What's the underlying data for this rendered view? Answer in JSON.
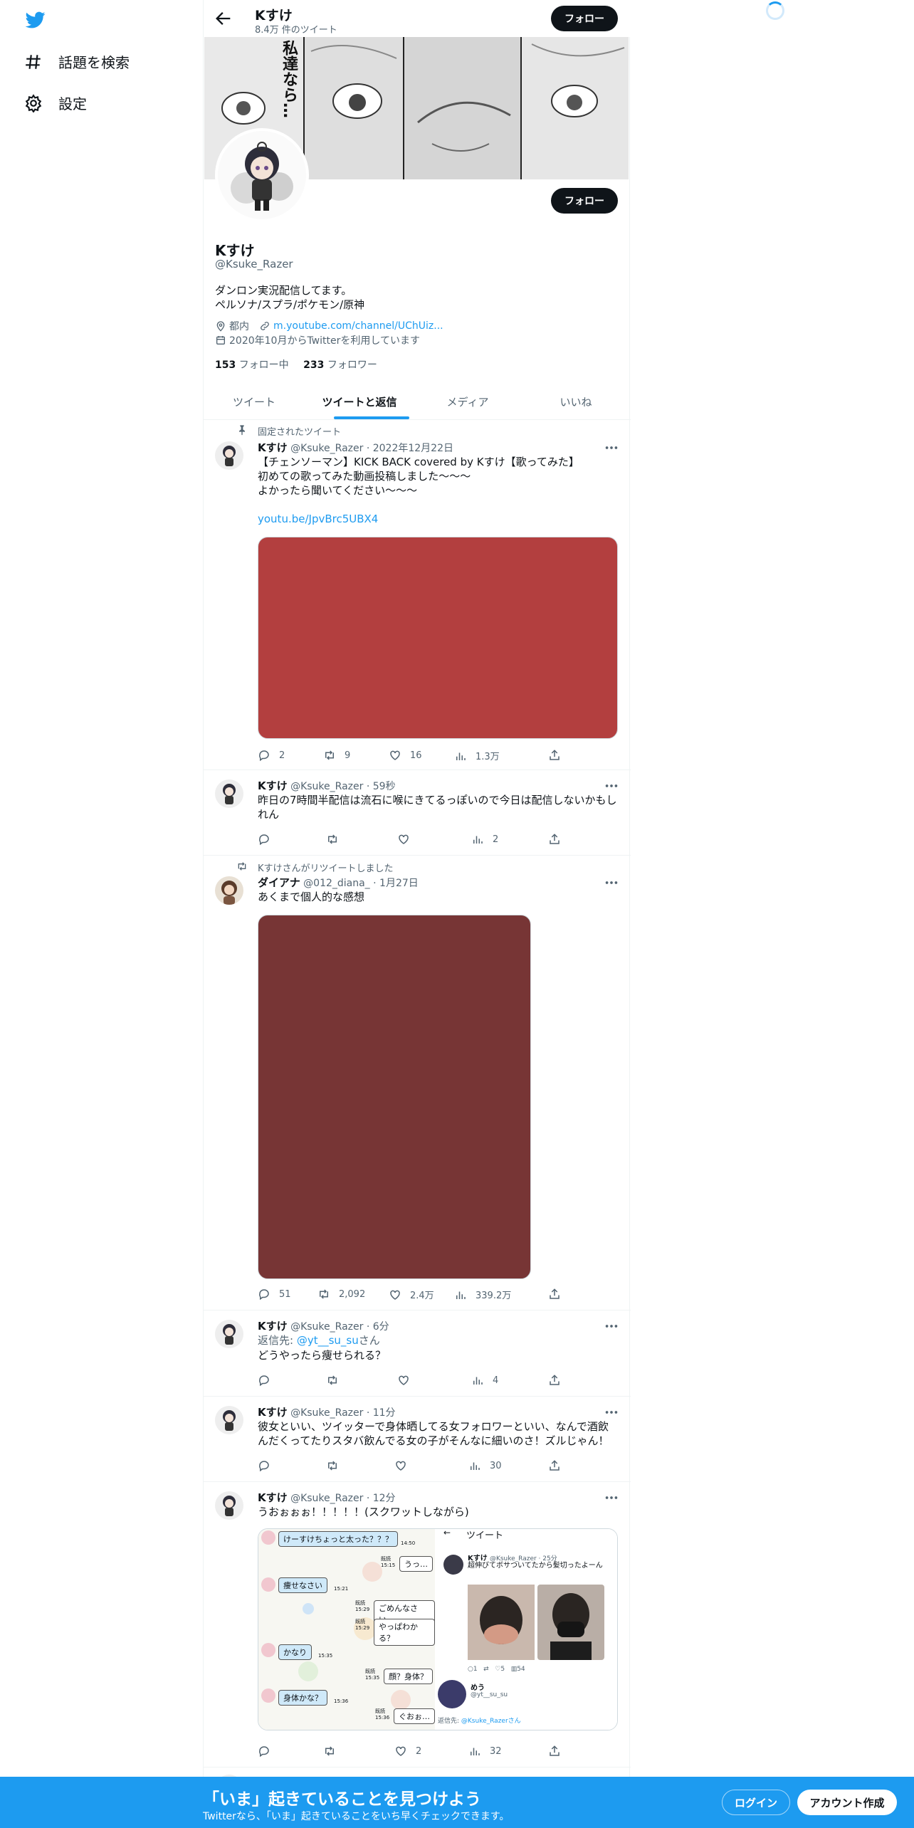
{
  "nav": {
    "items": [
      {
        "label": "話題を検索",
        "icon": "hashtag-icon"
      },
      {
        "label": "設定",
        "icon": "gear-icon"
      }
    ]
  },
  "header": {
    "name": "Kすけ",
    "tweet_count": "8.4万 件のツイート",
    "follow_label": "フォロー"
  },
  "banner": {
    "caption_text": "私達なら…"
  },
  "profile": {
    "follow_label": "フォロー",
    "name": "Kすけ",
    "handle": "@Ksuke_Razer",
    "bio_line1": "ダンロン実況配信してます。",
    "bio_line2": "ペルソナ/スプラ/ポケモン/原神",
    "location": "都内",
    "url": "m.youtube.com/channel/UChUiz...",
    "joined": "2020年10月からTwitterを利用しています",
    "following_count": "153",
    "following_label": "フォロー中",
    "followers_count": "233",
    "followers_label": "フォロワー"
  },
  "tabs": [
    {
      "label": "ツイート",
      "active": false
    },
    {
      "label": "ツイートと返信",
      "active": true
    },
    {
      "label": "メディア",
      "active": false
    },
    {
      "label": "いいね",
      "active": false
    }
  ],
  "tweets": [
    {
      "context": "固定されたツイート",
      "name": "Kすけ",
      "handle": "@Ksuke_Razer",
      "time": "· 2022年12月22日",
      "text": "【チェンソーマン】KICK BACK covered by Kすけ【歌ってみた】\n初めての歌ってみた動画投稿しました～～～\nよかったら聞いてください～～～",
      "link": "youtu.be/JpvBrc5UBX4",
      "media_color": "#b33f3f",
      "replies": "2",
      "retweets": "9",
      "likes": "16",
      "views": "1.3万"
    },
    {
      "name": "Kすけ",
      "handle": "@Ksuke_Razer",
      "time": "· 59秒",
      "text": "昨日の7時間半配信は流石に喉にきてるっぽいので今日は配信しないかもし\nれん",
      "replies": "",
      "retweets": "",
      "likes": "",
      "views": "2"
    },
    {
      "context": "Kすけさんがリツイートしました",
      "name": "ダイアナ",
      "handle": "@012_diana_",
      "time": "· 1月27日",
      "text": "あくまで個人的な感想",
      "media_color": "#773535",
      "replies": "51",
      "retweets": "2,092",
      "likes": "2.4万",
      "views": "339.2万"
    },
    {
      "name": "Kすけ",
      "handle": "@Ksuke_Razer",
      "time": "· 6分",
      "reply_prefix": "返信先: ",
      "reply_to": "@yt__su_su",
      "reply_suffix": "さん",
      "text": "どうやったら痩せられる？",
      "replies": "",
      "retweets": "",
      "likes": "",
      "views": "4"
    },
    {
      "name": "Kすけ",
      "handle": "@Ksuke_Razer",
      "time": "· 11分",
      "text": "彼女といい、ツイッターで身体晒してる女フォロワーといい、なんで酒飲\nんだくってたりスタバ飲んでる女の子がそんなに細いのさ！ズルじゃん！",
      "replies": "",
      "retweets": "",
      "likes": "",
      "views": "30"
    },
    {
      "name": "Kすけ",
      "handle": "@Ksuke_Razer",
      "time": "· 12分",
      "text": "うおぉぉぉ！！！！！(スクワットしながら)",
      "replies": "",
      "retweets": "",
      "likes": "2",
      "views": "32"
    }
  ],
  "chat_screenshot": {
    "bubbles_left": [
      "けーすけちょっと太った？？？",
      "痩せなさい",
      "かなり",
      "身体かな？"
    ],
    "bubbles_right": [
      "うっ…",
      "ごめんなさい…",
      "やっぱわかる？",
      "顔？身体？",
      "ぐおぉ…"
    ],
    "times_left": [
      "14:50",
      "15:21",
      "15:35",
      "15:36"
    ],
    "read_label": "既読",
    "times_right": [
      "15:15",
      "15:29",
      "15:29",
      "15:35",
      "15:36"
    ],
    "inner_header": "ツイート",
    "inner_name": "Kすけ",
    "inner_meta": "@Ksuke_Razer · 25分",
    "inner_text": "超伸びてボサついてたから髪切ったよーん",
    "inner_stats": [
      "1",
      "5",
      "54"
    ],
    "reply_name": "めう",
    "reply_handle": "@yt__su_su",
    "reply_to_label": "返信先: ",
    "reply_to_handle": "@Ksuke_Razerさん"
  },
  "bottom_bar": {
    "title": "「いま」起きていることを見つけよう",
    "subtitle": "Twitterなら、「いま」起きていることをいち早くチェックできます。",
    "login": "ログイン",
    "signup": "アカウント作成"
  }
}
